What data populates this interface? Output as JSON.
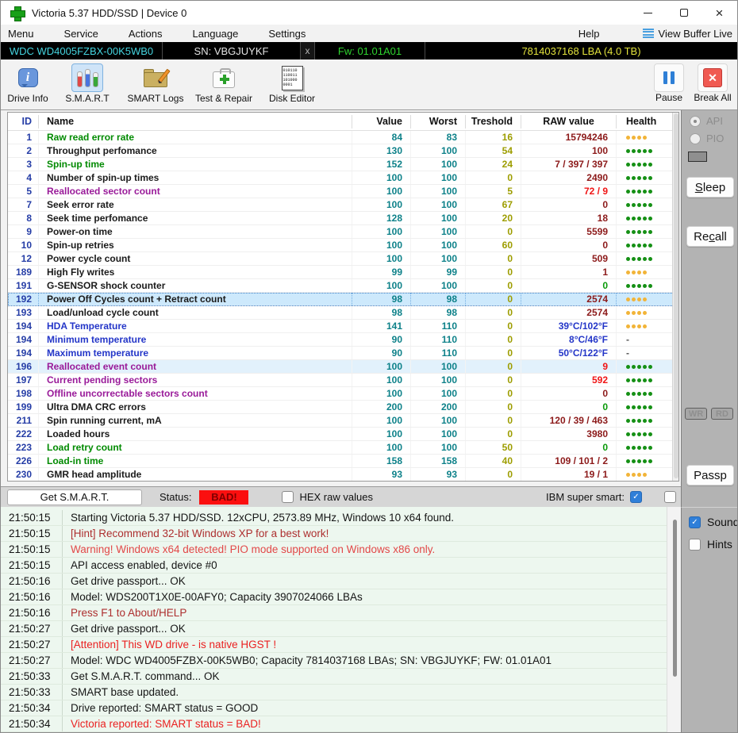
{
  "window": {
    "title": "Victoria 5.37 HDD/SSD | Device 0"
  },
  "menubar": {
    "items": [
      "Menu",
      "Service",
      "Actions",
      "Language",
      "Settings"
    ],
    "help": "Help",
    "view_buffer_live": "View Buffer Live"
  },
  "device_bar": {
    "model": "WDC WD4005FZBX-00K5WB0",
    "serial": "SN: VBGJUYKF",
    "x_button": "x",
    "firmware": "Fw: 01.01A01",
    "capacity": "7814037168 LBA (4.0 TB)"
  },
  "toolbar": {
    "drive_info": "Drive Info",
    "smart": "S.M.A.R.T",
    "smart_logs": "SMART Logs",
    "test_repair": "Test & Repair",
    "disk_editor": "Disk Editor",
    "disk_editor_binary": [
      "010110",
      "110011",
      "101000",
      "0001"
    ],
    "pause": "Pause",
    "break_all": "Break All"
  },
  "table": {
    "headers": {
      "id": "ID",
      "name": "Name",
      "value": "Value",
      "worst": "Worst",
      "treshold": "Treshold",
      "raw": "RAW value",
      "health": "Health"
    },
    "rows": [
      {
        "id": "1",
        "name": "Raw read error rate",
        "name_color": "green",
        "value": "84",
        "worst": "83",
        "treshold": "16",
        "raw": "15794246",
        "raw_color": "maroon",
        "health": {
          "count": 4,
          "color": "orange"
        }
      },
      {
        "id": "2",
        "name": "Throughput perfomance",
        "name_color": "black",
        "value": "130",
        "worst": "100",
        "treshold": "54",
        "raw": "100",
        "raw_color": "maroon",
        "health": {
          "count": 5,
          "color": "green"
        }
      },
      {
        "id": "3",
        "name": "Spin-up time",
        "name_color": "green",
        "value": "152",
        "worst": "100",
        "treshold": "24",
        "raw": "7 / 397 / 397",
        "raw_color": "maroon",
        "health": {
          "count": 5,
          "color": "green"
        }
      },
      {
        "id": "4",
        "name": "Number of spin-up times",
        "name_color": "black",
        "value": "100",
        "worst": "100",
        "treshold": "0",
        "raw": "2490",
        "raw_color": "maroon",
        "health": {
          "count": 5,
          "color": "green"
        }
      },
      {
        "id": "5",
        "name": "Reallocated sector count",
        "name_color": "purple",
        "value": "100",
        "worst": "100",
        "treshold": "5",
        "raw": "72 / 9",
        "raw_color": "red",
        "health": {
          "count": 5,
          "color": "green"
        }
      },
      {
        "id": "7",
        "name": "Seek error rate",
        "name_color": "black",
        "value": "100",
        "worst": "100",
        "treshold": "67",
        "raw": "0",
        "raw_color": "maroon",
        "health": {
          "count": 5,
          "color": "green"
        }
      },
      {
        "id": "8",
        "name": "Seek time perfomance",
        "name_color": "black",
        "value": "128",
        "worst": "100",
        "treshold": "20",
        "raw": "18",
        "raw_color": "maroon",
        "health": {
          "count": 5,
          "color": "green"
        }
      },
      {
        "id": "9",
        "name": "Power-on time",
        "name_color": "black",
        "value": "100",
        "worst": "100",
        "treshold": "0",
        "raw": "5599",
        "raw_color": "maroon",
        "health": {
          "count": 5,
          "color": "green"
        }
      },
      {
        "id": "10",
        "name": "Spin-up retries",
        "name_color": "black",
        "value": "100",
        "worst": "100",
        "treshold": "60",
        "raw": "0",
        "raw_color": "maroon",
        "health": {
          "count": 5,
          "color": "green"
        }
      },
      {
        "id": "12",
        "name": "Power cycle count",
        "name_color": "black",
        "value": "100",
        "worst": "100",
        "treshold": "0",
        "raw": "509",
        "raw_color": "maroon",
        "health": {
          "count": 5,
          "color": "green"
        }
      },
      {
        "id": "189",
        "name": "High Fly writes",
        "name_color": "black",
        "value": "99",
        "worst": "99",
        "treshold": "0",
        "raw": "1",
        "raw_color": "maroon",
        "health": {
          "count": 4,
          "color": "orange"
        }
      },
      {
        "id": "191",
        "name": "G-SENSOR shock counter",
        "name_color": "black",
        "value": "100",
        "worst": "100",
        "treshold": "0",
        "raw": "0",
        "raw_color": "green",
        "health": {
          "count": 5,
          "color": "green"
        }
      },
      {
        "id": "192",
        "name": "Power Off Cycles count + Retract count",
        "name_color": "black",
        "value": "98",
        "worst": "98",
        "treshold": "0",
        "raw": "2574",
        "raw_color": "maroon",
        "health": {
          "count": 4,
          "color": "orange"
        },
        "selected": true
      },
      {
        "id": "193",
        "name": "Load/unload cycle count",
        "name_color": "black",
        "value": "98",
        "worst": "98",
        "treshold": "0",
        "raw": "2574",
        "raw_color": "maroon",
        "health": {
          "count": 4,
          "color": "orange"
        }
      },
      {
        "id": "194",
        "name": "HDA Temperature",
        "name_color": "blue",
        "value": "141",
        "worst": "110",
        "treshold": "0",
        "raw": "39°C/102°F",
        "raw_color": "blue",
        "health": {
          "count": 4,
          "color": "orange"
        }
      },
      {
        "id": "194",
        "name": "Minimum temperature",
        "name_color": "blue",
        "value": "90",
        "worst": "110",
        "treshold": "0",
        "raw": "8°C/46°F",
        "raw_color": "blue",
        "health": {
          "dash": true
        }
      },
      {
        "id": "194",
        "name": "Maximum temperature",
        "name_color": "blue",
        "value": "90",
        "worst": "110",
        "treshold": "0",
        "raw": "50°C/122°F",
        "raw_color": "blue",
        "health": {
          "dash": true
        }
      },
      {
        "id": "196",
        "name": "Reallocated event count",
        "name_color": "purple",
        "value": "100",
        "worst": "100",
        "treshold": "0",
        "raw": "9",
        "raw_color": "red",
        "health": {
          "count": 5,
          "color": "green"
        },
        "highlight": true
      },
      {
        "id": "197",
        "name": "Current pending sectors",
        "name_color": "purple",
        "value": "100",
        "worst": "100",
        "treshold": "0",
        "raw": "592",
        "raw_color": "red",
        "health": {
          "count": 5,
          "color": "green"
        }
      },
      {
        "id": "198",
        "name": "Offline uncorrectable sectors count",
        "name_color": "purple",
        "value": "100",
        "worst": "100",
        "treshold": "0",
        "raw": "0",
        "raw_color": "maroon",
        "health": {
          "count": 5,
          "color": "green"
        }
      },
      {
        "id": "199",
        "name": "Ultra DMA CRC errors",
        "name_color": "black",
        "value": "200",
        "worst": "200",
        "treshold": "0",
        "raw": "0",
        "raw_color": "green",
        "health": {
          "count": 5,
          "color": "green"
        }
      },
      {
        "id": "211",
        "name": "Spin running current, mA",
        "name_color": "black",
        "value": "100",
        "worst": "100",
        "treshold": "0",
        "raw": "120 / 39 / 463",
        "raw_color": "maroon",
        "health": {
          "count": 5,
          "color": "green"
        }
      },
      {
        "id": "222",
        "name": "Loaded hours",
        "name_color": "black",
        "value": "100",
        "worst": "100",
        "treshold": "0",
        "raw": "3980",
        "raw_color": "maroon",
        "health": {
          "count": 5,
          "color": "green"
        }
      },
      {
        "id": "223",
        "name": "Load retry count",
        "name_color": "green",
        "value": "100",
        "worst": "100",
        "treshold": "50",
        "raw": "0",
        "raw_color": "green",
        "health": {
          "count": 5,
          "color": "green"
        }
      },
      {
        "id": "226",
        "name": "Load-in time",
        "name_color": "green",
        "value": "158",
        "worst": "158",
        "treshold": "40",
        "raw": "109 / 101 / 2",
        "raw_color": "maroon",
        "health": {
          "count": 5,
          "color": "green"
        }
      },
      {
        "id": "230",
        "name": "GMR head amplitude",
        "name_color": "black",
        "value": "93",
        "worst": "93",
        "treshold": "0",
        "raw": "19 / 1",
        "raw_color": "maroon",
        "health": {
          "count": 4,
          "color": "orange"
        }
      }
    ]
  },
  "side_panel": {
    "api": "API",
    "pio": "PIO",
    "sleep": "Sleep",
    "sleep_underline": 0,
    "recall": "Recall",
    "recall_underline": 2,
    "wr": "WR",
    "rd": "RD",
    "passp": "Passp"
  },
  "smart_bar": {
    "get_smart": "Get S.M.A.R.T.",
    "status_label": "Status:",
    "status_value": "BAD!",
    "hex_label": "HEX raw values",
    "ibm_label": "IBM super smart:"
  },
  "bottom_panel": {
    "sound": "Sound",
    "hints": "Hints"
  },
  "log": [
    {
      "time": "21:50:15",
      "text": "Starting Victoria 5.37 HDD/SSD. 12xCPU, 2573.89 MHz, Windows 10 x64 found.",
      "color": "#151515"
    },
    {
      "time": "21:50:15",
      "text": "[Hint] Recommend 32-bit Windows XP for a best work!",
      "color": "#ad2f2f"
    },
    {
      "time": "21:50:15",
      "text": "Warning! Windows x64 detected! PIO mode supported on Windows x86 only.",
      "color": "#e24848"
    },
    {
      "time": "21:50:15",
      "text": "API access enabled, device #0",
      "color": "#151515"
    },
    {
      "time": "21:50:16",
      "text": "Get drive passport... OK",
      "color": "#151515"
    },
    {
      "time": "21:50:16",
      "text": "Model: WDS200T1X0E-00AFY0; Capacity 3907024066 LBAs",
      "color": "#151515"
    },
    {
      "time": "21:50:16",
      "text": "Press F1 to About/HELP",
      "color": "#ad2f2f"
    },
    {
      "time": "21:50:27",
      "text": "Get drive passport... OK",
      "color": "#151515"
    },
    {
      "time": "21:50:27",
      "text": "[Attention] This WD drive - is native HGST !",
      "color": "#ea2121"
    },
    {
      "time": "21:50:27",
      "text": "Model: WDC WD4005FZBX-00K5WB0; Capacity 7814037168 LBAs; SN: VBGJUYKF; FW: 01.01A01",
      "color": "#151515"
    },
    {
      "time": "21:50:33",
      "text": "Get S.M.A.R.T. command... OK",
      "color": "#151515"
    },
    {
      "time": "21:50:33",
      "text": "SMART base updated.",
      "color": "#151515"
    },
    {
      "time": "21:50:34",
      "text": "Drive reported: SMART status = GOOD",
      "color": "#151515"
    },
    {
      "time": "21:50:34",
      "text": "Victoria reported: SMART status = BAD!",
      "color": "#ea2121"
    }
  ],
  "colors": {
    "name": {
      "green": "#008a00",
      "black": "#1a1a1a",
      "purple": "#991a99",
      "blue": "#2436c8"
    },
    "raw": {
      "maroon": "#8c1a1a",
      "red": "#f01515",
      "green": "#0a9a0a",
      "blue": "#2436c8"
    },
    "value_teal": "#0d8189",
    "treshold_olive": "#9d9d00",
    "health": {
      "green": "#159015",
      "orange": "#f2b438"
    },
    "status_bad_bg": "#fb0f0f"
  }
}
